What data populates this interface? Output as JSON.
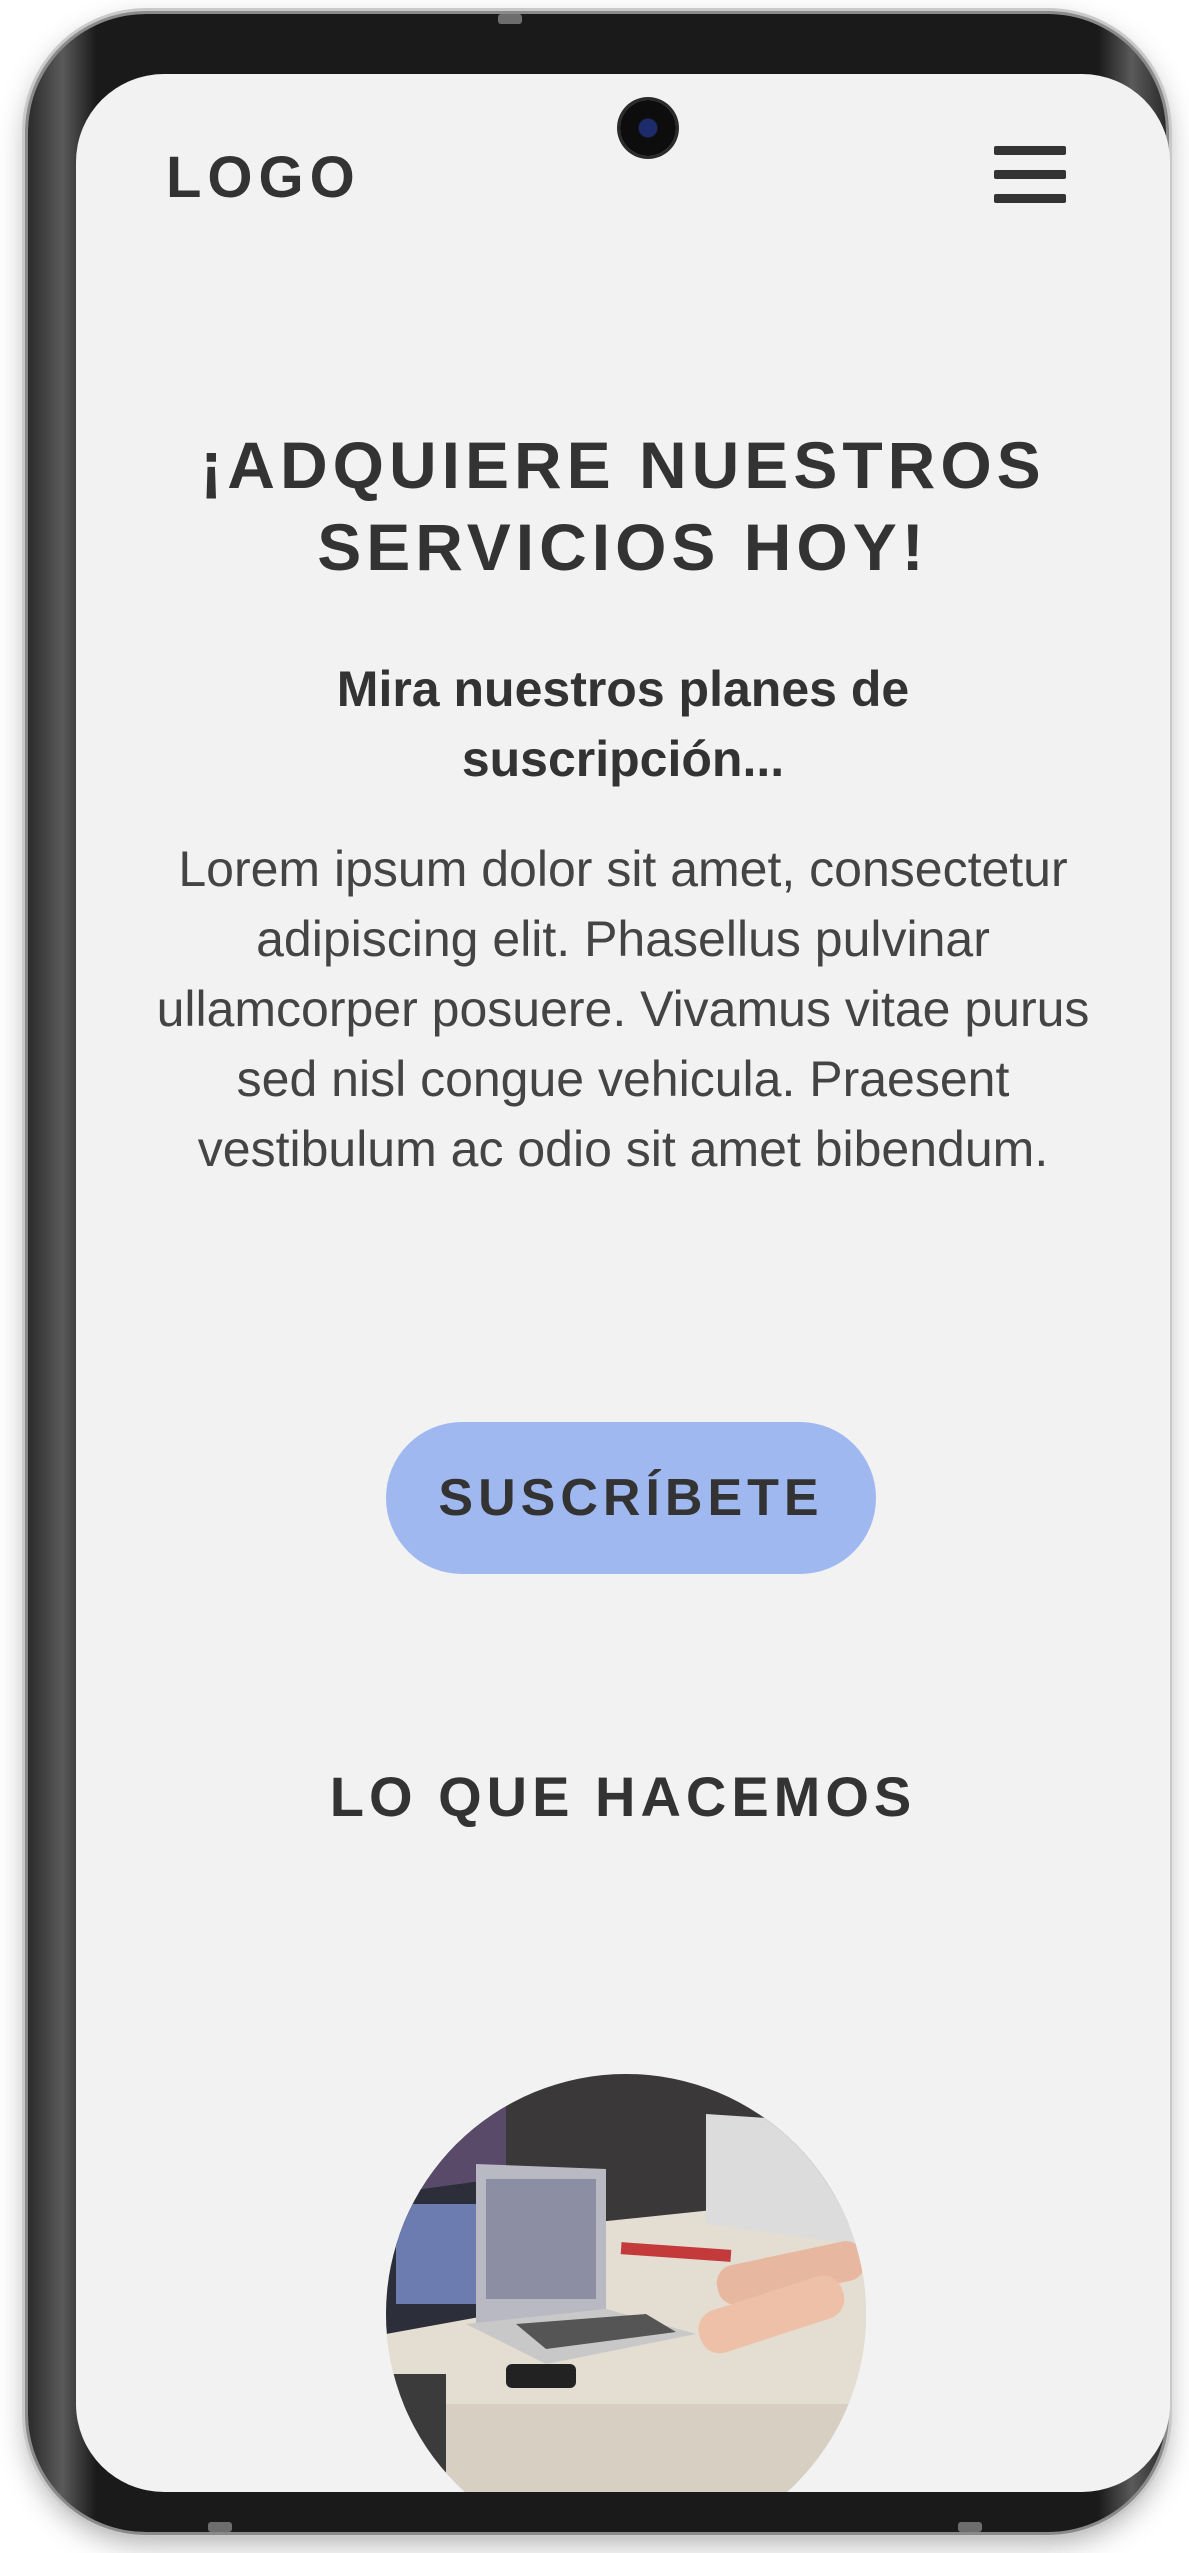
{
  "header": {
    "logo_text": "LOGO",
    "menu_icon": "hamburger-menu-icon"
  },
  "hero": {
    "title": "¡ADQUIERE NUESTROS SERVICIOS HOY!",
    "subtitle": "Mira nuestros planes de suscripción...",
    "body": "Lorem ipsum dolor sit amet, consectetur adipiscing elit. Phasellus pulvinar ullamcorper posuere. Vivamus vitae purus sed nisl congue vehicula. Praesent vestibulum ac odio sit amet bibendum.",
    "cta_label": "SUSCRÍBETE"
  },
  "services": {
    "title": "LO QUE HACEMOS"
  },
  "colors": {
    "background": "#f2f2f2",
    "accent_button": "#9fb8f0",
    "text": "#333333"
  }
}
